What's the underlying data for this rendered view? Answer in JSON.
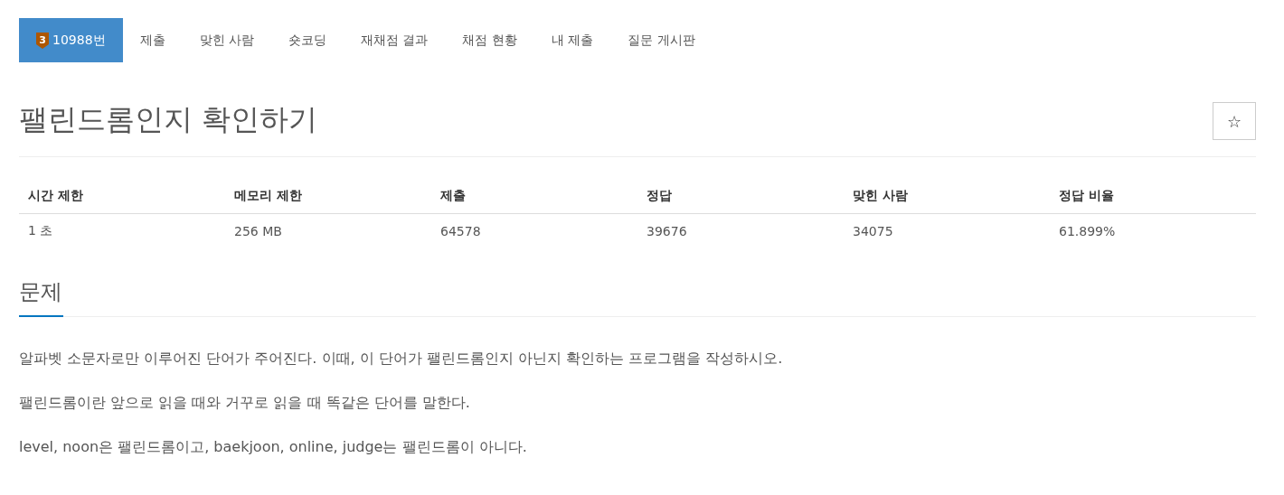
{
  "tabs": [
    {
      "label": "10988번",
      "tier": "3",
      "selected": true
    },
    {
      "label": "제출",
      "selected": false
    },
    {
      "label": "맞힌 사람",
      "selected": false
    },
    {
      "label": "숏코딩",
      "selected": false
    },
    {
      "label": "재채점 결과",
      "selected": false
    },
    {
      "label": "채점 현황",
      "selected": false
    },
    {
      "label": "내 제출",
      "selected": false
    },
    {
      "label": "질문 게시판",
      "selected": false
    }
  ],
  "title": "팰린드롬인지 확인하기",
  "star_button": {
    "label": "☆"
  },
  "info_table": {
    "columns": [
      "시간 제한",
      "메모리 제한",
      "제출",
      "정답",
      "맞힌 사람",
      "정답 비율"
    ],
    "rows": [
      [
        "1 초",
        "256 MB",
        "64578",
        "39676",
        "34075",
        "61.899%"
      ]
    ]
  },
  "section": {
    "heading": "문제",
    "paragraphs": [
      "알파벳 소문자로만 이루어진 단어가 주어진다. 이때, 이 단어가 팰린드롬인지 아닌지 확인하는 프로그램을 작성하시오.",
      "팰린드롬이란 앞으로 읽을 때와 거꾸로 읽을 때 똑같은 단어를 말한다.",
      "level, noon은 팰린드롬이고, baekjoon, online, judge는 팰린드롬이 아니다."
    ]
  }
}
